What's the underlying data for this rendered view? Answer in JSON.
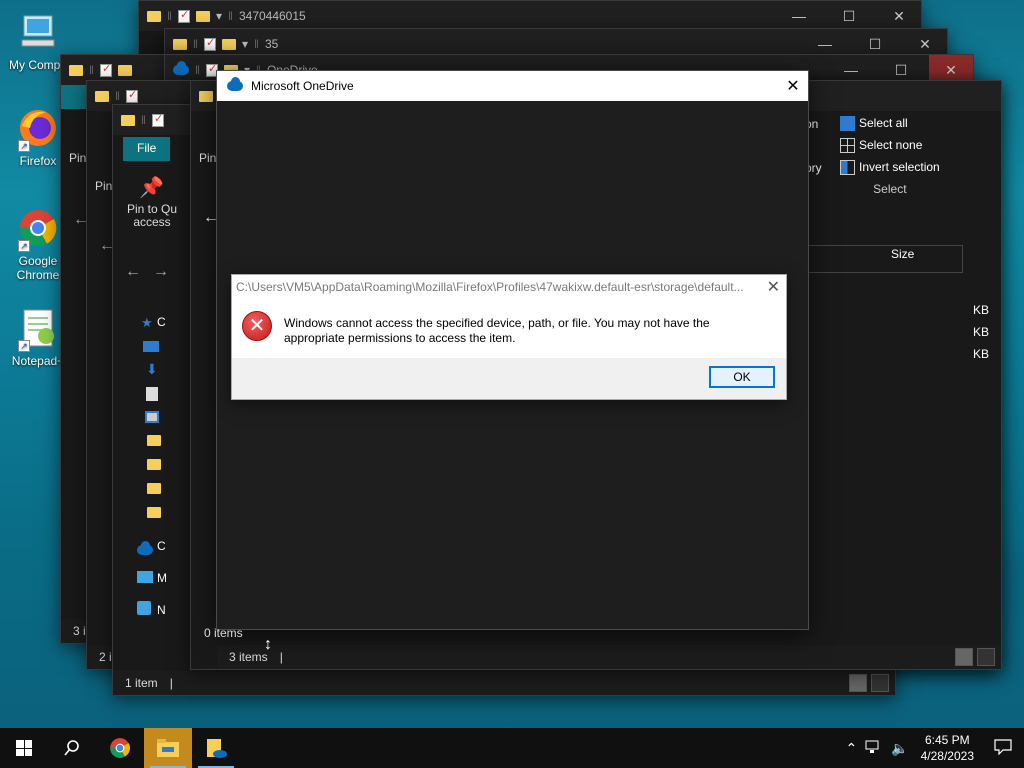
{
  "desktop": {
    "icons": [
      {
        "label": "My Compu",
        "icon": "computer-icon"
      },
      {
        "label": "Firefox",
        "icon": "firefox-icon"
      },
      {
        "label": "Google Chrome",
        "icon": "chrome-icon"
      },
      {
        "label": "Notepad+",
        "icon": "notepadpp-icon"
      }
    ]
  },
  "explorer_windows": [
    {
      "title": "3470446015",
      "status": "",
      "file_tab": "F"
    },
    {
      "title": "35",
      "status": "",
      "file_tab": "F"
    },
    {
      "title": "OneDrive",
      "status": "3 items",
      "file_tab": "F"
    },
    {
      "title": "",
      "status": "2 i",
      "file_tab": "F"
    },
    {
      "title": "",
      "status": "1 item",
      "file_tab": "File"
    },
    {
      "title": "",
      "status": "0 items",
      "file_tab": "F"
    }
  ],
  "background_text": {
    "pin_to_quick_access": "Pin to Qu access",
    "pin_short": "Pin",
    "nav_c": "C",
    "nav_m": "M",
    "nav_n": "N",
    "one_i": "1 i",
    "size_header": "Size",
    "kb": "KB",
    "ory": "ory",
    "on": "on",
    "n_suffix": "n"
  },
  "ribbon_select": {
    "select_all": "Select all",
    "select_none": "Select none",
    "invert_selection": "Invert selection",
    "group_label": "Select"
  },
  "onedrive_window": {
    "title": "Microsoft OneDrive",
    "status": "0 items"
  },
  "error_dialog": {
    "title": "C:\\Users\\VM5\\AppData\\Roaming\\Mozilla\\Firefox\\Profiles\\47wakixw.default-esr\\storage\\default...",
    "message": "Windows cannot access the specified device, path, or file. You may not have the appropriate permissions to access the item.",
    "ok_label": "OK"
  },
  "taskbar": {
    "apps": [
      "start-icon",
      "search-icon",
      "chrome-icon",
      "file-explorer-icon",
      "onedrive-explorer-icon"
    ],
    "time": "6:45 PM",
    "date": "4/28/2023"
  },
  "colors": {
    "accent": "#0e7380",
    "dialog_button_border": "#0078d7",
    "error_red": "#c81818"
  }
}
